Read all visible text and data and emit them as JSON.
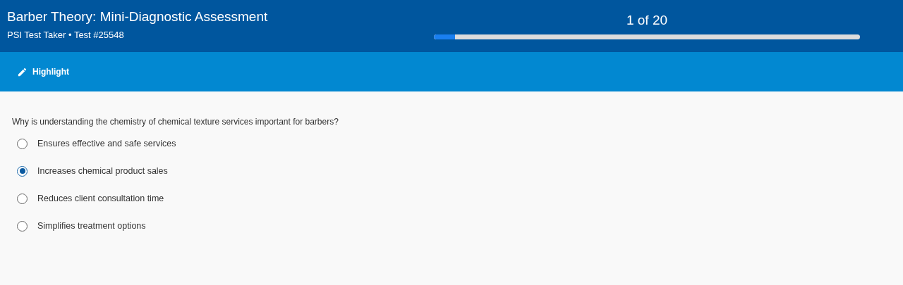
{
  "header": {
    "title": "Barber Theory: Mini-Diagnostic Assessment",
    "subtitle": "PSI Test Taker • Test #25548",
    "progress": {
      "label": "1 of 20",
      "level": 0.05
    }
  },
  "toolbar": {
    "buttons": [
      {
        "label": "Highlight"
      }
    ]
  },
  "question": {
    "text": "Why is understanding the chemistry of chemical texture services important for barbers?",
    "options": [
      {
        "label": "Ensures effective and safe services",
        "selected": false
      },
      {
        "label": "Increases chemical product sales",
        "selected": true
      },
      {
        "label": "Reduces client consultation time",
        "selected": false
      },
      {
        "label": "Simplifies treatment options",
        "selected": false
      }
    ]
  }
}
